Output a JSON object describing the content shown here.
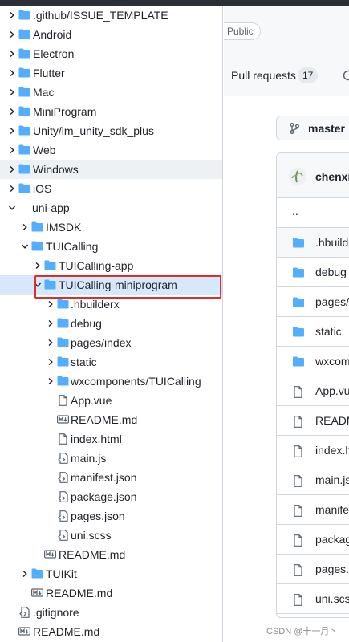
{
  "tree": {
    "rows": [
      {
        "label": ".github/ISSUE_TEMPLATE",
        "kind": "folder",
        "state": "collapsed"
      },
      {
        "label": "Android",
        "kind": "folder",
        "state": "collapsed"
      },
      {
        "label": "Electron",
        "kind": "folder",
        "state": "collapsed"
      },
      {
        "label": "Flutter",
        "kind": "folder",
        "state": "collapsed"
      },
      {
        "label": "Mac",
        "kind": "folder",
        "state": "collapsed"
      },
      {
        "label": "MiniProgram",
        "kind": "folder",
        "state": "collapsed"
      },
      {
        "label": "Unity/im_unity_sdk_plus",
        "kind": "folder",
        "state": "collapsed"
      },
      {
        "label": "Web",
        "kind": "folder",
        "state": "collapsed"
      },
      {
        "label": "Windows",
        "kind": "folder",
        "state": "collapsed",
        "hover": true
      },
      {
        "label": "iOS",
        "kind": "folder",
        "state": "collapsed"
      },
      {
        "label": "uni-app",
        "kind": "none",
        "state": "expanded"
      },
      {
        "label": "IMSDK",
        "kind": "folder",
        "state": "collapsed"
      },
      {
        "label": "TUICalling",
        "kind": "folder",
        "state": "expanded"
      },
      {
        "label": "TUICalling-app",
        "kind": "folder",
        "state": "collapsed"
      },
      {
        "label": "TUICalling-miniprogram",
        "kind": "folder",
        "state": "expanded",
        "selected": true
      },
      {
        "label": ".hbuilderx",
        "kind": "folder",
        "state": "collapsed"
      },
      {
        "label": "debug",
        "kind": "folder",
        "state": "collapsed"
      },
      {
        "label": "pages/index",
        "kind": "folder",
        "state": "collapsed"
      },
      {
        "label": "static",
        "kind": "folder",
        "state": "collapsed"
      },
      {
        "label": "wxcomponents/TUICalling",
        "kind": "folder",
        "state": "collapsed"
      },
      {
        "label": "App.vue",
        "kind": "file"
      },
      {
        "label": "README.md",
        "kind": "markdown"
      },
      {
        "label": "index.html",
        "kind": "file"
      },
      {
        "label": "main.js",
        "kind": "code"
      },
      {
        "label": "manifest.json",
        "kind": "code"
      },
      {
        "label": "package.json",
        "kind": "code"
      },
      {
        "label": "pages.json",
        "kind": "code"
      },
      {
        "label": "uni.scss",
        "kind": "code"
      },
      {
        "label": "README.md",
        "kind": "markdown"
      },
      {
        "label": "TUIKit",
        "kind": "folder",
        "state": "collapsed"
      },
      {
        "label": "README.md",
        "kind": "markdown"
      },
      {
        "label": ".gitignore",
        "kind": "code"
      },
      {
        "label": "README.md",
        "kind": "markdown"
      }
    ]
  },
  "repo": {
    "visibility": "Public",
    "tab_pull_requests": "Pull requests",
    "tab_pull_requests_count": "17",
    "branch": "master",
    "commit_user": "chenxi",
    "files": [
      {
        "name": "..",
        "kind": "up"
      },
      {
        "name": ".hbuilderx",
        "kind": "folder"
      },
      {
        "name": "debug",
        "kind": "folder"
      },
      {
        "name": "pages/index",
        "kind": "folder"
      },
      {
        "name": "static",
        "kind": "folder"
      },
      {
        "name": "wxcomponents/TUICalling",
        "kind": "folder"
      },
      {
        "name": "App.vue",
        "kind": "file"
      },
      {
        "name": "README.md",
        "kind": "file"
      },
      {
        "name": "index.html",
        "kind": "file"
      },
      {
        "name": "main.js",
        "kind": "file"
      },
      {
        "name": "manifest.json",
        "kind": "file"
      },
      {
        "name": "package.json",
        "kind": "file"
      },
      {
        "name": "pages.json",
        "kind": "file"
      },
      {
        "name": "uni.scss",
        "kind": "file"
      }
    ]
  },
  "watermark": "CSDN @十一月丶",
  "colors": {
    "folder": "#54aeff",
    "selected_row": "#d7e8fb",
    "selection_outline": "#d9302c",
    "border": "#d0d7de"
  }
}
